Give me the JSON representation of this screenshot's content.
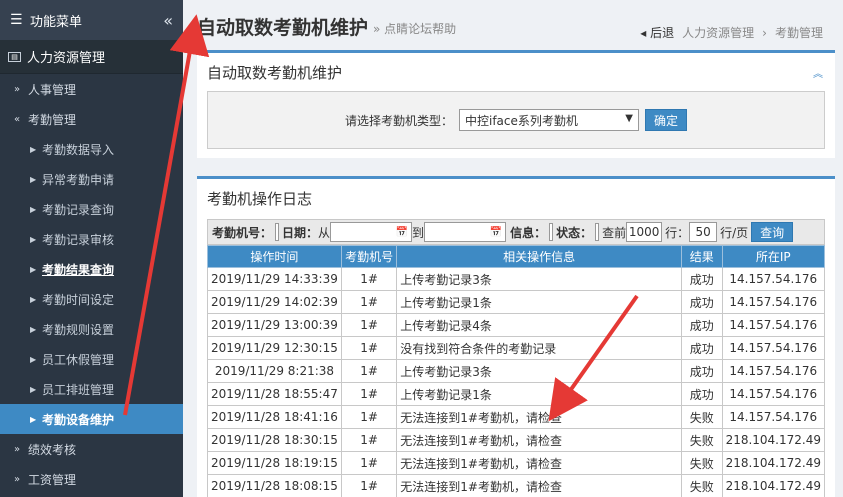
{
  "sidebar": {
    "header": "功能菜单",
    "collapse_icon": "«",
    "section": "人力资源管理",
    "groups": [
      {
        "label": "人事管理"
      },
      {
        "label": "考勤管理"
      }
    ],
    "items": [
      "考勤数据导入",
      "异常考勤申请",
      "考勤记录查询",
      "考勤记录审核",
      "考勤结果查询",
      "考勤时间设定",
      "考勤规则设置",
      "员工休假管理",
      "员工排班管理",
      "考勤设备维护"
    ],
    "bottom_groups": [
      "绩效考核",
      "工资管理"
    ]
  },
  "header": {
    "title": "自动取数考勤机维护",
    "subtitle": "» 点睛论坛帮助",
    "back": "后退",
    "crumb1": "人力资源管理",
    "crumb_sep": "›",
    "crumb2": "考勤管理"
  },
  "panel1": {
    "title": "自动取数考勤机维护",
    "label": "请选择考勤机类型：",
    "select_value": "中控iface系列考勤机",
    "confirm": "确定"
  },
  "panel2": {
    "title": "考勤机操作日志",
    "filter": {
      "device_label": "考勤机号：",
      "date_label": "日期：",
      "from": "从",
      "to": "到",
      "info_label": "信息：",
      "status_label": "状态：",
      "query_prefix": "查前",
      "count": "1000",
      "rows_label": "行：",
      "page_size": "50",
      "per_page": "行/页",
      "query_btn": "查询"
    },
    "columns": [
      "操作时间",
      "考勤机号",
      "相关操作信息",
      "结果",
      "所在IP"
    ],
    "rows": [
      [
        "2019/11/29 14:33:39",
        "1#",
        "上传考勤记录3条",
        "成功",
        "14.157.54.176"
      ],
      [
        "2019/11/29 14:02:39",
        "1#",
        "上传考勤记录1条",
        "成功",
        "14.157.54.176"
      ],
      [
        "2019/11/29 13:00:39",
        "1#",
        "上传考勤记录4条",
        "成功",
        "14.157.54.176"
      ],
      [
        "2019/11/29 12:30:15",
        "1#",
        "没有找到符合条件的考勤记录",
        "成功",
        "14.157.54.176"
      ],
      [
        "2019/11/29 8:21:38",
        "1#",
        "上传考勤记录3条",
        "成功",
        "14.157.54.176"
      ],
      [
        "2019/11/28 18:55:47",
        "1#",
        "上传考勤记录1条",
        "成功",
        "14.157.54.176"
      ],
      [
        "2019/11/28 18:41:16",
        "1#",
        "无法连接到1#考勤机，请检查",
        "失败",
        "14.157.54.176"
      ],
      [
        "2019/11/28 18:30:15",
        "1#",
        "无法连接到1#考勤机，请检查",
        "失败",
        "218.104.172.49"
      ],
      [
        "2019/11/28 18:19:15",
        "1#",
        "无法连接到1#考勤机，请检查",
        "失败",
        "218.104.172.49"
      ],
      [
        "2019/11/28 18:08:15",
        "1#",
        "无法连接到1#考勤机，请检查",
        "失败",
        "218.104.172.49"
      ]
    ]
  },
  "colors": {
    "accent": "#3e8ac4",
    "sidebar_bg": "#2b3643",
    "arrow": "#e53935"
  }
}
